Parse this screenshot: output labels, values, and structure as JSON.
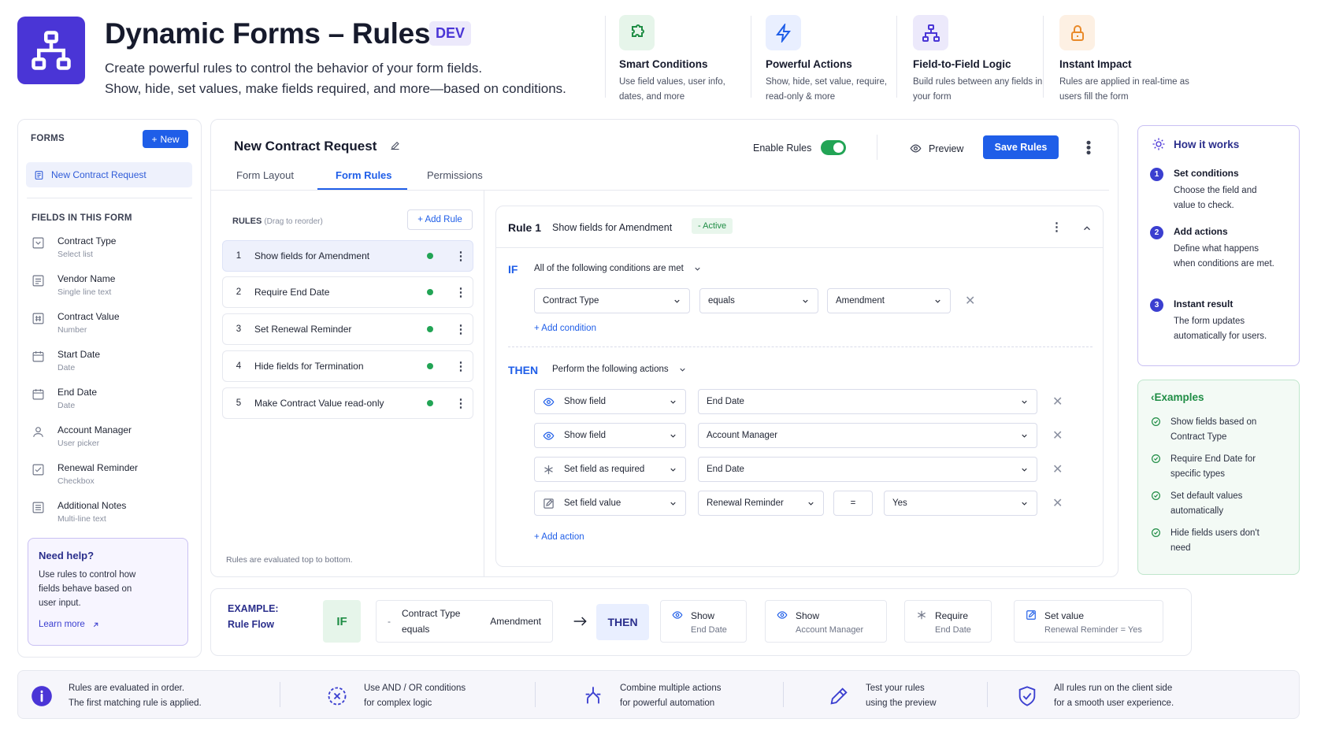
{
  "header": {
    "title": "Dynamic Forms – Rules",
    "badge": "DEV",
    "subtitle_line1": "Create powerful rules to control the behavior of your form fields.",
    "subtitle_line2": "Show, hide, set values, make fields required, and more—based on conditions."
  },
  "features": [
    {
      "title": "Smart Conditions",
      "desc": "Use field values, user info, dates, and more",
      "icon": "puzzle-icon",
      "color": "#1f8d45",
      "bg": "#e6f5ea"
    },
    {
      "title": "Powerful Actions",
      "desc": "Show, hide, set value, require, read-only & more",
      "icon": "lightning-icon",
      "color": "#1f5ee8",
      "bg": "#e9efff"
    },
    {
      "title": "Field-to-Field Logic",
      "desc": "Build rules between any fields in your form",
      "icon": "hierarchy-icon",
      "color": "#4a35d6",
      "bg": "#ece9fb"
    },
    {
      "title": "Instant Impact",
      "desc": "Rules are applied in real-time as users fill the form",
      "icon": "lock-icon",
      "color": "#e98a2a",
      "bg": "#fdf0e3"
    }
  ],
  "sidebar": {
    "forms_heading": "FORMS",
    "new_button": "New",
    "form_item": "New Contract Request",
    "fields_heading": "FIELDS IN THIS FORM",
    "fields": [
      {
        "name": "Contract Type",
        "type": "Select list",
        "icon": "select-icon"
      },
      {
        "name": "Vendor Name",
        "type": "Single line text",
        "icon": "text-icon"
      },
      {
        "name": "Contract Value",
        "type": "Number",
        "icon": "number-icon"
      },
      {
        "name": "Start Date",
        "type": "Date",
        "icon": "calendar-icon"
      },
      {
        "name": "End Date",
        "type": "Date",
        "icon": "calendar-icon"
      },
      {
        "name": "Account Manager",
        "type": "User picker",
        "icon": "user-icon"
      },
      {
        "name": "Renewal Reminder",
        "type": "Checkbox",
        "icon": "checkbox-icon"
      },
      {
        "name": "Additional Notes",
        "type": "Multi-line text",
        "icon": "notes-icon"
      }
    ],
    "help": {
      "title": "Need help?",
      "desc": "Use rules to control how fields behave based on user input.",
      "link": "Learn more"
    }
  },
  "main": {
    "form_title": "New Contract Request",
    "tabs": [
      "Form Layout",
      "Form Rules",
      "Permissions"
    ],
    "enable_label": "Enable Rules",
    "preview_label": "Preview",
    "save_label": "Save Rules",
    "rules_heading": "RULES",
    "rules_hint": "(Drag to reorder)",
    "add_rule": "+ Add Rule",
    "rules": [
      {
        "num": "1",
        "name": "Show fields for Amendment"
      },
      {
        "num": "2",
        "name": "Require End Date"
      },
      {
        "num": "3",
        "name": "Set Renewal Reminder"
      },
      {
        "num": "4",
        "name": "Hide fields for Termination"
      },
      {
        "num": "5",
        "name": "Make Contract Value read-only"
      }
    ],
    "rules_footer": "Rules are evaluated top to bottom."
  },
  "editor": {
    "rule_label": "Rule 1",
    "rule_name": "Show fields for Amendment",
    "status": "Active",
    "if_label": "IF",
    "if_mode": "All of the following conditions are met",
    "condition": {
      "field": "Contract Type",
      "operator": "equals",
      "value": "Amendment"
    },
    "add_condition": "+ Add condition",
    "then_label": "THEN",
    "then_mode": "Perform the following actions",
    "actions": [
      {
        "action": "Show field",
        "target": "End Date",
        "icon": "eye-icon"
      },
      {
        "action": "Show field",
        "target": "Account Manager",
        "icon": "eye-icon"
      },
      {
        "action": "Set field as required",
        "target": "End Date",
        "icon": "asterisk-icon"
      },
      {
        "action": "Set field value",
        "target": "Renewal Reminder",
        "op": "=",
        "value": "Yes",
        "icon": "edit-icon"
      }
    ],
    "add_action": "+ Add action"
  },
  "how_it_works": {
    "title": "How it works",
    "steps": [
      {
        "num": "1",
        "title": "Set conditions",
        "desc": "Choose the field and value to check."
      },
      {
        "num": "2",
        "title": "Add actions",
        "desc": "Define what happens when conditions are met."
      },
      {
        "num": "3",
        "title": "Instant result",
        "desc": "The form updates automatically for users."
      }
    ]
  },
  "examples": {
    "title": "Examples",
    "items": [
      "Show fields based on Contract Type",
      "Require End Date for specific types",
      "Set default values automatically",
      "Hide fields users don't need"
    ]
  },
  "flow": {
    "label_line1": "EXAMPLE:",
    "label_line2": "Rule Flow",
    "if": "IF",
    "cond_field": "Contract Type",
    "cond_op": "equals",
    "cond_value": "Amendment",
    "then": "THEN",
    "actions": [
      {
        "title": "Show",
        "detail": "End Date",
        "icon": "eye-icon"
      },
      {
        "title": "Show",
        "detail": "Account Manager",
        "icon": "eye-icon"
      },
      {
        "title": "Require",
        "detail": "End Date",
        "icon": "asterisk-icon"
      },
      {
        "title": "Set value",
        "detail": "Renewal Reminder = Yes",
        "icon": "edit-icon"
      }
    ]
  },
  "tips": [
    {
      "line1": "Rules are evaluated in order.",
      "line2": "The first matching rule is applied.",
      "icon": "info-icon"
    },
    {
      "line1": "Use AND / OR conditions",
      "line2": "for complex logic",
      "icon": "logic-icon"
    },
    {
      "line1": "Combine multiple actions",
      "line2": "for powerful automation",
      "icon": "combine-icon"
    },
    {
      "line1": "Test your rules",
      "line2": "using the preview",
      "icon": "pencil-icon"
    },
    {
      "line1": "All rules run on the client side",
      "line2": "for a smooth user experience.",
      "icon": "shield-icon"
    }
  ]
}
